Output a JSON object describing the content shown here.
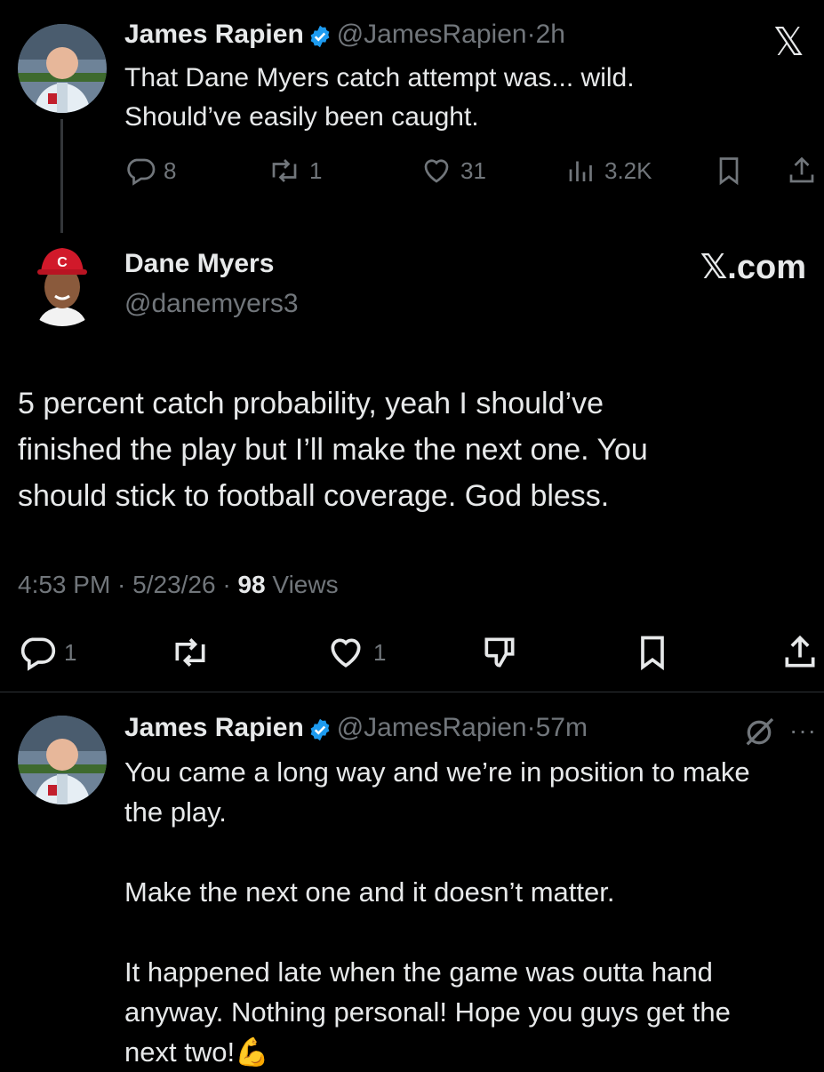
{
  "branding": {
    "x_logo": "𝕏",
    "xcom": "𝕏.com"
  },
  "tweet1": {
    "name": "James Rapien",
    "handle": "@JamesRapien",
    "sep": "·",
    "time": "2h",
    "lines": [
      "That Dane Myers catch attempt was... wild.",
      "Should’ve easily been caught."
    ],
    "reply_count": "8",
    "retweet_count": "1",
    "like_count": "31",
    "view_count": "3.2K"
  },
  "tweet2": {
    "name": "Dane Myers",
    "handle": "@danemyers3",
    "lines": [
      "5 percent catch probability, yeah I should’ve",
      "finished the play but I’ll make the next one. You",
      "should stick to football coverage. God bless."
    ],
    "timestamp": "4:53 PM · 5/23/26 · ",
    "views_count": "98",
    "views_label": " Views",
    "reply_count": "1",
    "like_count": "1"
  },
  "tweet3": {
    "name": "James Rapien",
    "handle": "@JamesRapien",
    "sep": "·",
    "time": "57m",
    "lines": [
      "You came a long way and we’re in position to make",
      "the play.",
      "",
      "Make the next one and it doesn’t matter.",
      "",
      "It happened late when the game was outta hand",
      "anyway. Nothing personal! Hope you guys get the",
      "next two!💪"
    ]
  },
  "colors": {
    "verified": "#1d9bf0",
    "muted": "#71767b",
    "text": "#e7e9ea",
    "divider": "#2f3336"
  }
}
